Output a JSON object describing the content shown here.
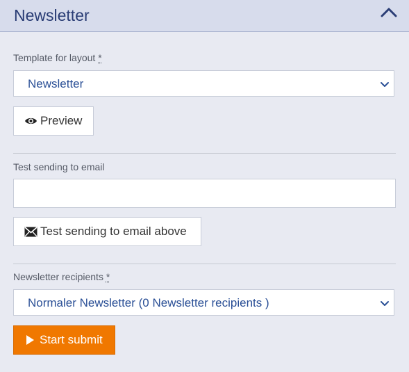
{
  "header": {
    "title": "Newsletter",
    "collapse_icon": "chevron-up-icon"
  },
  "layout_template": {
    "label": "Template for layout",
    "required_mark": "*",
    "selected": "Newsletter"
  },
  "preview_button": {
    "label": "Preview",
    "icon": "eye-icon"
  },
  "test_email": {
    "label": "Test sending to email",
    "value": "",
    "button_label": "Test sending to email above",
    "button_icon": "envelope-icon"
  },
  "recipients": {
    "label": "Newsletter recipients",
    "required_mark": "*",
    "selected": "Normaler Newsletter (0 Newsletter recipients )"
  },
  "submit": {
    "label": "Start submit",
    "icon": "play-icon",
    "color": "#f07800"
  },
  "colors": {
    "background": "#e8eaf2",
    "header_background": "#d7dcec",
    "accent_text": "#2a3d75"
  }
}
